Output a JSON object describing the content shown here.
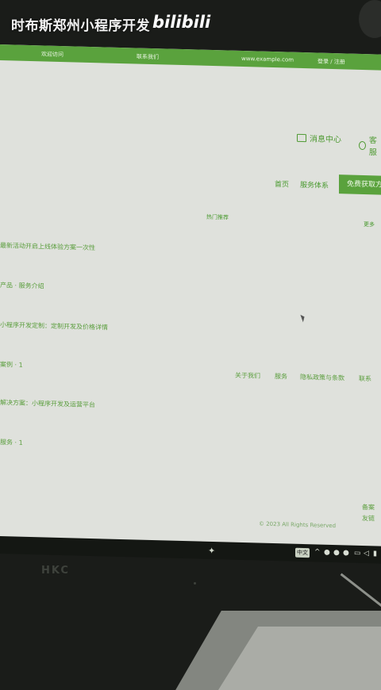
{
  "overlay": {
    "title": "时布斯郑州小程序开发",
    "logo": "bilibili"
  },
  "topbar": {
    "left": "欢迎访问",
    "center": "联系我们",
    "right_link": "www.example.com",
    "right_end": "登录 / 注册"
  },
  "header": {
    "util_1_label": "消息中心",
    "util_2_label": "客服"
  },
  "nav": {
    "link_1": "首页",
    "link_2": "服务体系",
    "primary_button": "免费获取方案"
  },
  "section": {
    "label_center": "热门推荐",
    "label_right": "更多"
  },
  "list": {
    "item_1": "最新活动开启上线体验方案一次性",
    "item_2": "产品 · 服务介绍",
    "item_3": "小程序开发定制：定制开发及价格详情",
    "item_4": "案例 · 1",
    "item_5": "解决方案：小程序开发及运营平台",
    "item_6": "服务 · 1"
  },
  "footer": {
    "links": [
      "关于我们",
      "服务",
      "隐私政策与条款",
      "联系"
    ],
    "right_1": "备案",
    "right_2": "友链",
    "copyright": "© 2023 All Rights Reserved"
  },
  "taskbar": {
    "tray_label": "中文"
  },
  "bezel": {
    "brand": "HKC"
  },
  "colors": {
    "accent": "#5aa23d",
    "page_bg": "#dfe1dc",
    "link": "#4f9a33"
  }
}
